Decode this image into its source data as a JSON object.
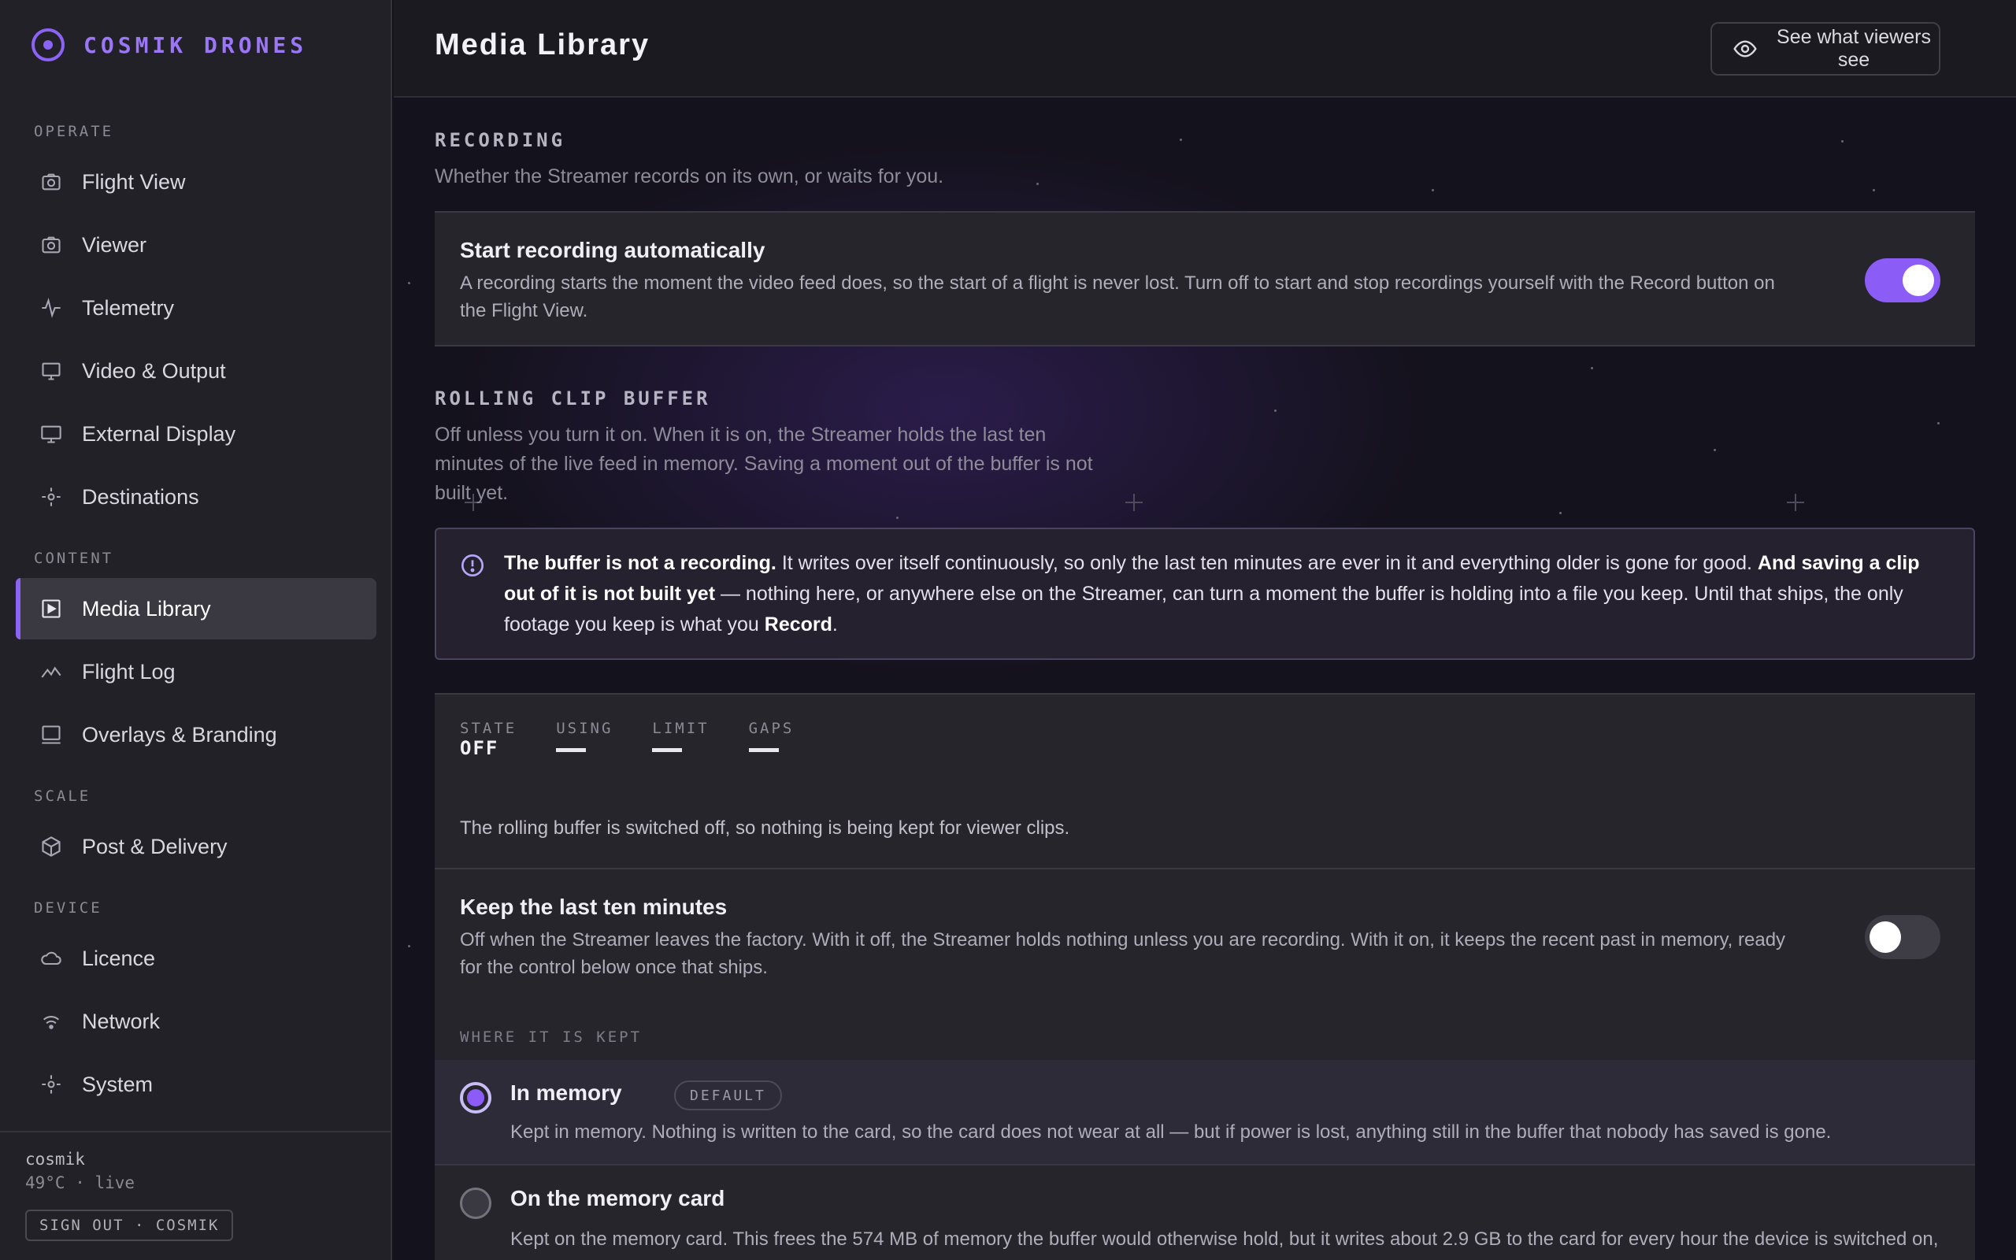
{
  "brand": {
    "name": "COSMIK DRONES"
  },
  "sidebar": {
    "sections": [
      {
        "label": "OPERATE"
      },
      {
        "label": "CONTENT"
      },
      {
        "label": "SCALE"
      },
      {
        "label": "DEVICE"
      }
    ],
    "items": [
      {
        "label": "Flight View",
        "icon": "camera-icon"
      },
      {
        "label": "Viewer",
        "icon": "camera-icon"
      },
      {
        "label": "Telemetry",
        "icon": "pulse-icon"
      },
      {
        "label": "Video & Output",
        "icon": "monitor-icon"
      },
      {
        "label": "External Display",
        "icon": "monitor-icon"
      },
      {
        "label": "Destinations",
        "icon": "broadcast-icon"
      },
      {
        "label": "Media Library",
        "icon": "play-square-icon",
        "active": true
      },
      {
        "label": "Flight Log",
        "icon": "chart-line-icon"
      },
      {
        "label": "Overlays & Branding",
        "icon": "screen-icon"
      },
      {
        "label": "Post & Delivery",
        "icon": "package-icon"
      },
      {
        "label": "Licence",
        "icon": "cloud-icon"
      },
      {
        "label": "Network",
        "icon": "wifi-icon"
      },
      {
        "label": "System",
        "icon": "gear-icon"
      }
    ],
    "footer": {
      "host": "cosmik",
      "status": "49°C · live",
      "signout": "SIGN OUT · COSMIK"
    }
  },
  "header": {
    "title": "Media Library",
    "viewers_button": "See what viewers see"
  },
  "recording": {
    "title": "RECORDING",
    "desc": "Whether the Streamer records on its own, or waits for you.",
    "auto": {
      "title": "Start recording automatically",
      "desc": "A recording starts the moment the video feed does, so the start of a flight is never lost. Turn off to start and stop recordings yourself with the Record button on the Flight View.",
      "enabled": true
    }
  },
  "buffer": {
    "title": "ROLLING CLIP BUFFER",
    "desc": "Off unless you turn it on. When it is on, the Streamer holds the last ten minutes of the live feed in memory. Saving a moment out of the buffer is not built yet.",
    "notice": {
      "b1": "The buffer is not a recording.",
      "t1": " It writes over itself continuously, so only the last ten minutes are ever in it and everything older is gone for good. ",
      "b2": "And saving a clip out of it is not built yet",
      "t2": " — nothing here, or anywhere else on the Streamer, can turn a moment the buffer is holding into a file you keep. Until that ships, the only footage you keep is what you ",
      "b3": "Record",
      "t3": "."
    },
    "stats": {
      "state_label": "STATE",
      "state_value": "OFF",
      "using_label": "USING",
      "limit_label": "LIMIT",
      "gaps_label": "GAPS"
    },
    "status_text": "The rolling buffer is switched off, so nothing is being kept for viewer clips.",
    "keep": {
      "title": "Keep the last ten minutes",
      "desc": "Off when the Streamer leaves the factory. With it off, the Streamer holds nothing unless you are recording. With it on, it keeps the recent past in memory, ready for the control below once that ships.",
      "enabled": false
    },
    "where_label": "WHERE IT IS KEPT",
    "options": [
      {
        "title": "In memory",
        "badge": "DEFAULT",
        "desc": "Kept in memory. Nothing is written to the card, so the card does not wear at all — but if power is lost, anything still in the buffer that nobody has saved is gone.",
        "selected": true
      },
      {
        "title": "On the memory card",
        "desc": "Kept on the memory card. This frees the 574 MB of memory the buffer would otherwise hold, but it writes about 2.9 GB to the card for every hour the device is switched on,",
        "selected": false
      }
    ]
  },
  "colors": {
    "accent": "#8b5cf6",
    "brand": "#9b77f7"
  }
}
